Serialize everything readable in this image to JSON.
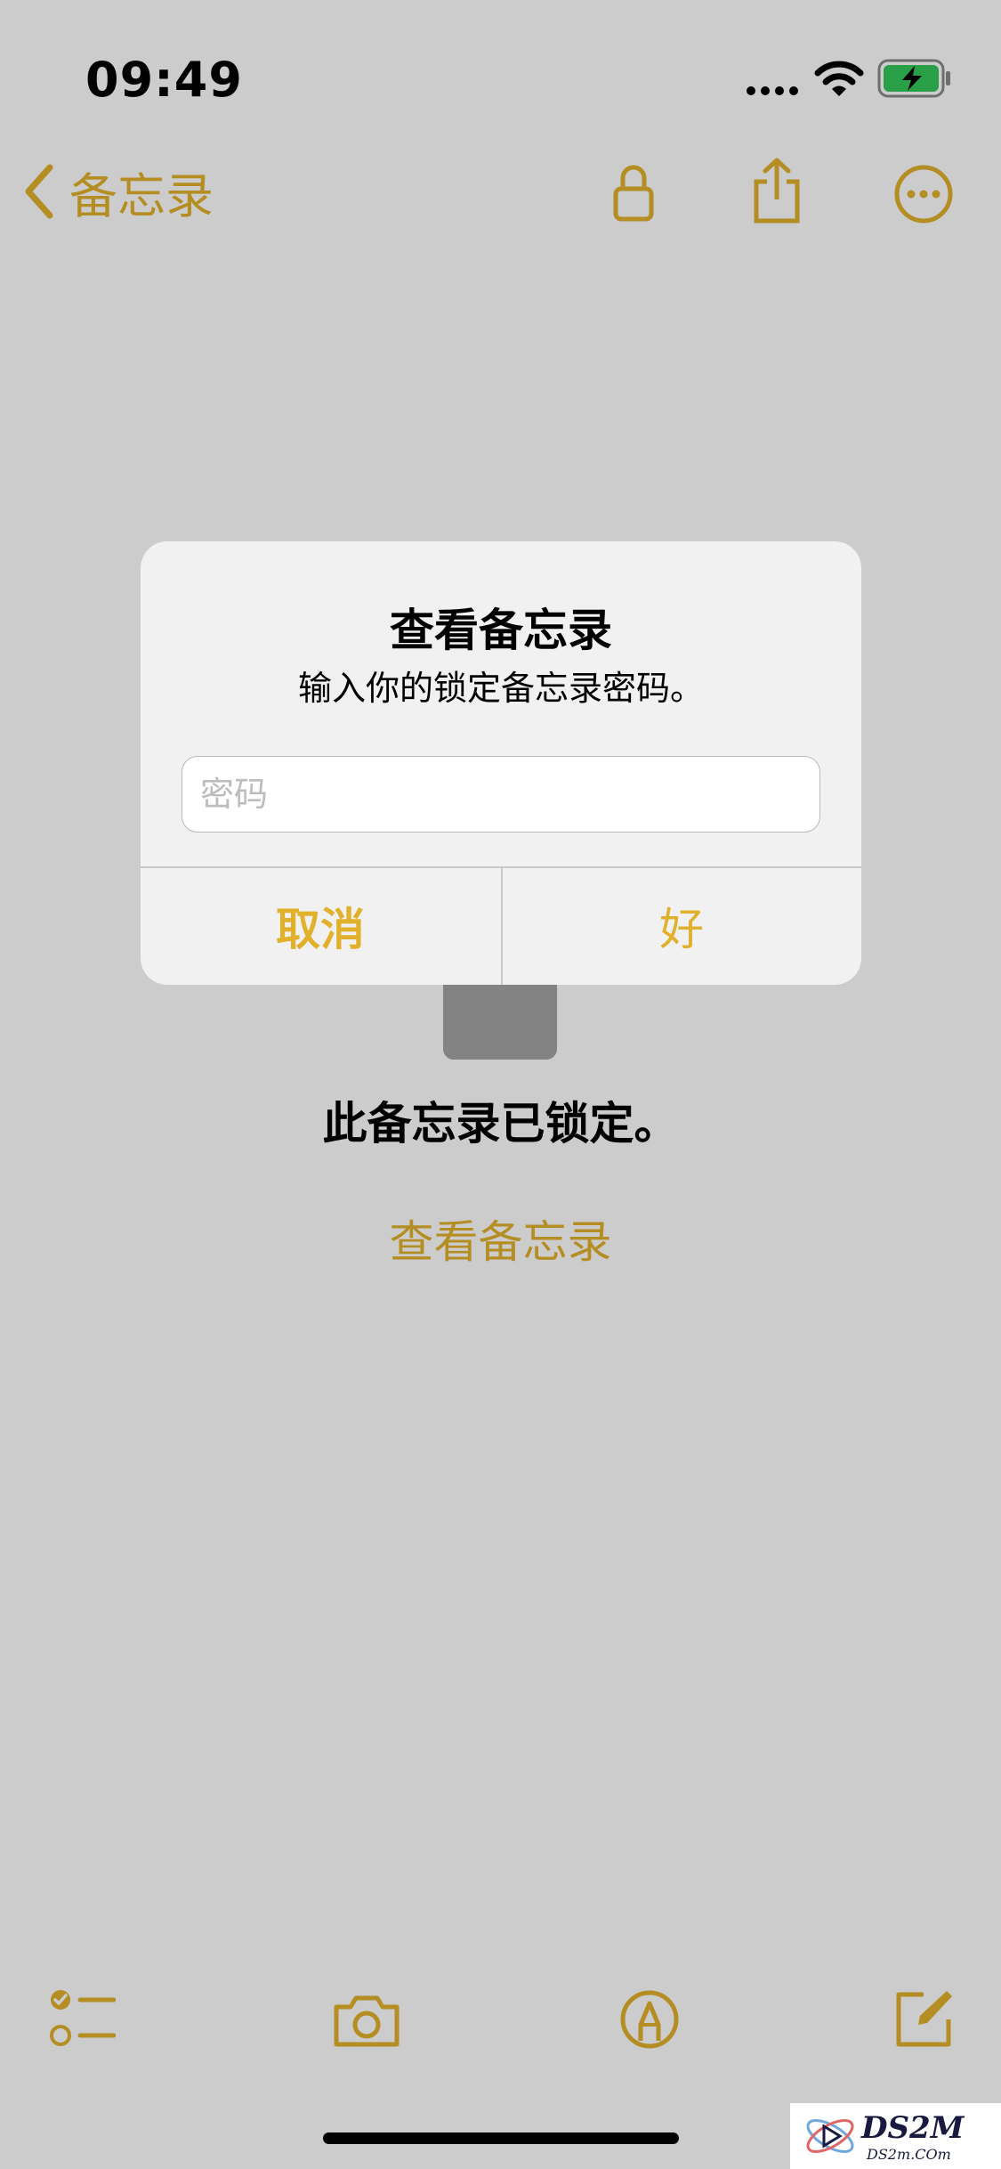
{
  "status_bar": {
    "time": "09:49",
    "icons": [
      "cellular-dots-icon",
      "wifi-icon",
      "battery-charging-icon"
    ]
  },
  "nav": {
    "back_label": "备忘录",
    "icons": [
      "lock-icon",
      "share-icon",
      "more-icon"
    ]
  },
  "content": {
    "locked_message": "此备忘录已锁定。",
    "view_link": "查看备忘录"
  },
  "alert": {
    "title": "查看备忘录",
    "message": "输入你的锁定备忘录密码。",
    "password_placeholder": "密码",
    "password_value": "",
    "cancel_label": "取消",
    "ok_label": "好"
  },
  "toolbar": {
    "icons": [
      "checklist-icon",
      "camera-icon",
      "markup-icon",
      "compose-icon"
    ]
  },
  "watermark": {
    "text": "DS2M",
    "subtext": "DS2m.COm"
  },
  "colors": {
    "accent": "#e1b12c",
    "dim_overlay": "rgba(0,0,0,0.2)",
    "alert_background": "#f1f1f1"
  }
}
